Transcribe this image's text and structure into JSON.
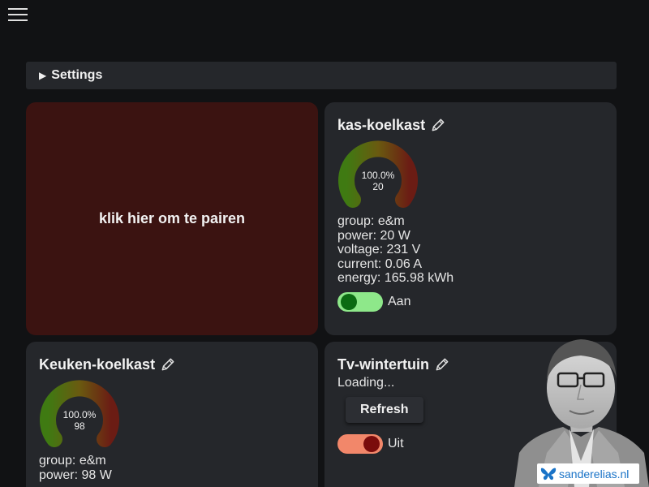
{
  "menu": {
    "icon": "hamburger-menu-icon"
  },
  "settings": {
    "label": "Settings",
    "icon": "triangle-right-icon"
  },
  "pair_card": {
    "label": "klik hier om te pairen",
    "color": "#3b1311"
  },
  "devices": [
    {
      "name": "kas-koelkast",
      "gauge": {
        "percent_label": "100.0%",
        "value_label": "20",
        "fraction": 1.0
      },
      "stats": [
        "group: e&m",
        "power: 20 W",
        "voltage: 231 V",
        "current: 0.06 A",
        "energy: 165.98 kWh"
      ],
      "toggle": {
        "state": "on",
        "label": "Aan"
      }
    },
    {
      "name": "Keuken-koelkast",
      "gauge": {
        "percent_label": "100.0%",
        "value_label": "98",
        "fraction": 1.0
      },
      "stats": [
        "group: e&m",
        "power: 98 W"
      ]
    },
    {
      "name": "Tv-wintertuin",
      "loading_text": "Loading...",
      "refresh_label": "Refresh",
      "toggle": {
        "state": "off",
        "label": "Uit"
      }
    }
  ],
  "watermark": {
    "text": "sanderelias.nl",
    "icon": "butterfly-icon"
  },
  "colors": {
    "background": "#111214",
    "card": "#25272b",
    "toggle_on": "#8ee88a",
    "toggle_off": "#f2876a",
    "watermark_text": "#1a73c7"
  }
}
